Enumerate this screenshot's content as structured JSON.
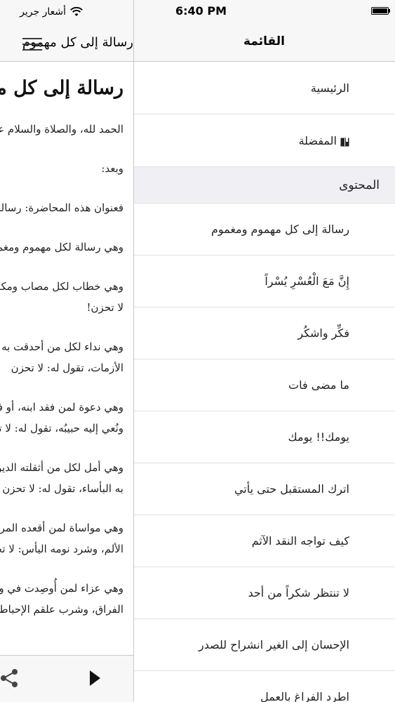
{
  "status_bar": {
    "carrier": "أشعار جرير",
    "time": "6:40 PM",
    "battery_level": 1.0
  },
  "content_view": {
    "nav_title": "رسالة إلى كل مهموم",
    "heading": "رسالة إلى كل مهموم ومغموم",
    "paragraphs": [
      "الحمد لله، والصلاة والسلام على رسول الله",
      "وبعد:",
      "فعنوان هذه المحاضرة: رسالة إلى كل مهموم",
      "وهي رسالة لكل مهموم ومغموم",
      "وهي خطاب لكل مصاب ومكروب، تقول له:",
      "لا تحزن!",
      "وهي نداء لكل من أحدقت به الهموم وأحاطت به",
      "الأزمات، تقول له: لا تحزن",
      "وهي دعوة لمن فقد ابنه، أو فارق أهله،",
      "ونُعي إليه حبيبُه، تقول له: لا تحزن",
      "وهي أمل لكل من أثقلته الديون، وحلّت",
      "به البأساء، تقول له: لا تحزن",
      "وهي مواساة لمن أقعده المرض، وأضناه",
      "الألم، وشرد نومه اليأس: لا تحزن",
      "وهي عزاء لمن أُوصِدت في وجهه الأبواب",
      "الفراق، وشرب علقم الإحباط: لا تحزن"
    ],
    "toolbar": {
      "play_icon": "play-icon",
      "share_icon": "share-icon"
    }
  },
  "menu": {
    "title": "القائمة",
    "top_items": [
      {
        "label": "الرئيسية"
      },
      {
        "label": "المفضلة",
        "icon": "bookmark-icon"
      }
    ],
    "section_title": "المحتوى",
    "content_items": [
      {
        "label": "رسالة إلى كل مهموم ومغموم"
      },
      {
        "label": "إِنَّ مَعَ الْعُسْرِ يُسْراً"
      },
      {
        "label": "فكِّر واشكُر"
      },
      {
        "label": "ما مضى فات"
      },
      {
        "label": "يومك!! يومك"
      },
      {
        "label": "اترك المستقبل حتى يأتي"
      },
      {
        "label": "كيف تواجه النقد الآثم"
      },
      {
        "label": "لا تنتظر شكراً من أحد"
      },
      {
        "label": "الإحسان إلى الغير انشراح للصدر"
      },
      {
        "label": "اطرد الفراغ بالعمل"
      }
    ]
  }
}
